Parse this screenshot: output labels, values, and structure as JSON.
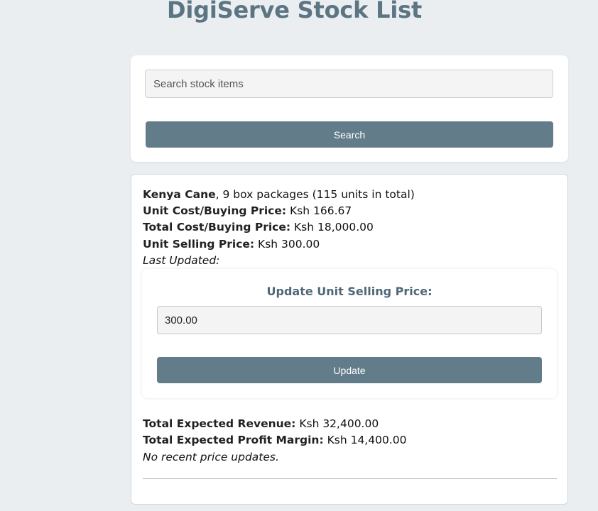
{
  "page": {
    "title": "DigiServe Stock List"
  },
  "search": {
    "placeholder": "Search stock items",
    "value": "",
    "button_label": "Search"
  },
  "item": {
    "name": "Kenya Cane",
    "description": ", 9 box packages (115 units in total)",
    "unit_cost_label": "Unit Cost/Buying Price:",
    "unit_cost_value": "Ksh 166.67",
    "total_cost_label": "Total Cost/Buying Price:",
    "total_cost_value": "Ksh 18,000.00",
    "unit_selling_label": "Unit Selling Price:",
    "unit_selling_value": "Ksh 300.00",
    "last_updated": "Last Updated:",
    "update": {
      "heading": "Update Unit Selling Price:",
      "input_value": "300.00",
      "button_label": "Update"
    },
    "revenue_label": "Total Expected Revenue:",
    "revenue_value": "Ksh 32,400.00",
    "profit_label": "Total Expected Profit Margin:",
    "profit_value": "Ksh 14,400.00",
    "recent_updates_note": "No recent price updates."
  },
  "colors": {
    "background": "#ebeef1",
    "accent": "#627c89",
    "title": "#5b7583"
  }
}
